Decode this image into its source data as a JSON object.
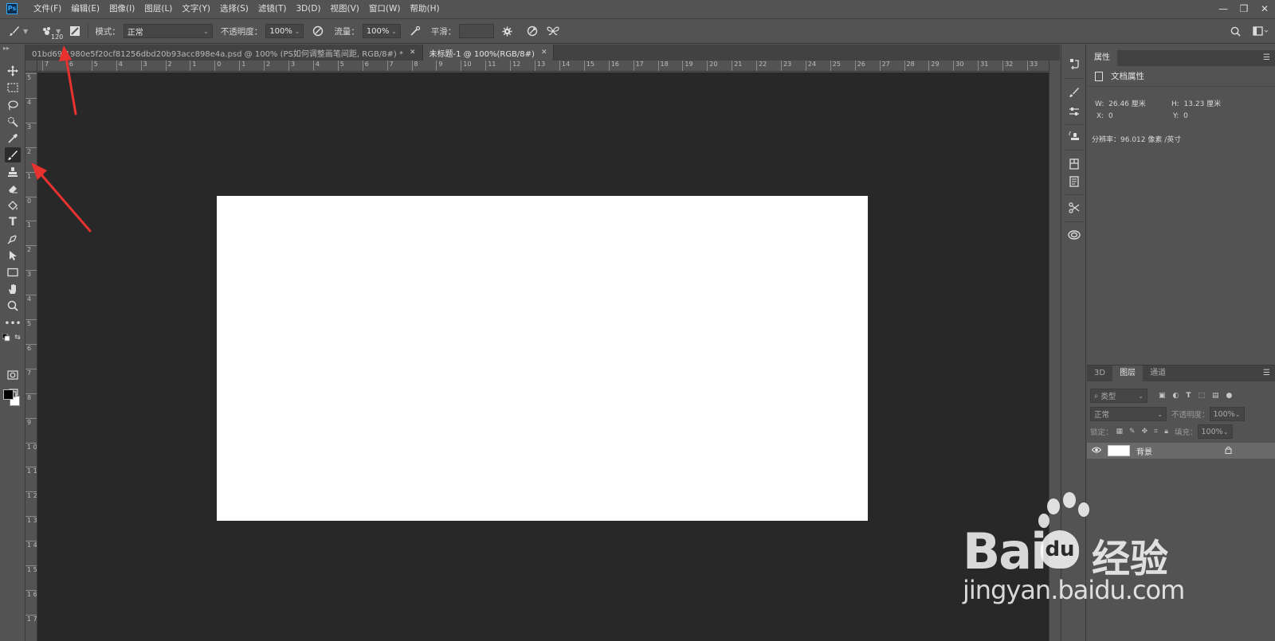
{
  "app": {
    "logo": "Ps"
  },
  "menu": [
    "文件(F)",
    "编辑(E)",
    "图像(I)",
    "图层(L)",
    "文字(Y)",
    "选择(S)",
    "滤镜(T)",
    "3D(D)",
    "视图(V)",
    "窗口(W)",
    "帮助(H)"
  ],
  "window_controls": {
    "minimize": "—",
    "restore": "❐",
    "close": "✕"
  },
  "options": {
    "brush_size": "120",
    "mode_label": "模式：",
    "mode_value": "正常",
    "opacity_label": "不透明度：",
    "opacity_value": "100%",
    "flow_label": "流量：",
    "flow_value": "100%",
    "smooth_label": "平滑："
  },
  "tabs": [
    {
      "label": "01bd69f1980e5f20cf81256dbd20b93acc898e4a.psd @ 100% (PS如何调整画笔间距, RGB/8#) *",
      "close": "✕"
    },
    {
      "label": "未标题-1 @ 100%(RGB/8#)",
      "close": "✕"
    }
  ],
  "ruler_top": [
    "7",
    "6",
    "5",
    "4",
    "3",
    "2",
    "1",
    "0",
    "1",
    "2",
    "3",
    "4",
    "5",
    "6",
    "7",
    "8",
    "9",
    "10",
    "11",
    "12",
    "13",
    "14",
    "15",
    "16",
    "17",
    "18",
    "19",
    "20",
    "21",
    "22",
    "23",
    "24",
    "25",
    "26",
    "27",
    "28",
    "29",
    "30",
    "31",
    "32",
    "33"
  ],
  "ruler_left": [
    "5",
    "4",
    "3",
    "2",
    "1",
    "0",
    "1",
    "2",
    "3",
    "4",
    "5",
    "6",
    "7",
    "8",
    "9",
    "1 0",
    "1 1",
    "1 2",
    "1 3",
    "1 4",
    "1 5",
    "1 6",
    "1 7"
  ],
  "properties": {
    "tab": "属性",
    "title": "文档属性",
    "w_label": "W:",
    "w_value": "26.46 厘米",
    "h_label": "H:",
    "h_value": "13.23 厘米",
    "x_label": "X:",
    "x_value": "0",
    "y_label": "Y:",
    "y_value": "0",
    "resolution": "分辨率：96.012 像素 /英寸"
  },
  "layers_panel": {
    "tabs": [
      "3D",
      "图层",
      "通道"
    ],
    "filter_placeholder": "类型",
    "blend_mode": "正常",
    "opacity_label": "不透明度：",
    "opacity_value": "100%",
    "lock_label": "锁定：",
    "fill_label": "填充：",
    "fill_value": "100%",
    "layer_name": "背景"
  },
  "watermark": {
    "word": "Bai",
    "du": "du",
    "jingyan": "经验",
    "url": "jingyan.baidu.com"
  },
  "colors": {
    "annotation_arrow": "#e8322f",
    "canvas_bg": "#282828",
    "ui_bg": "#535353"
  }
}
